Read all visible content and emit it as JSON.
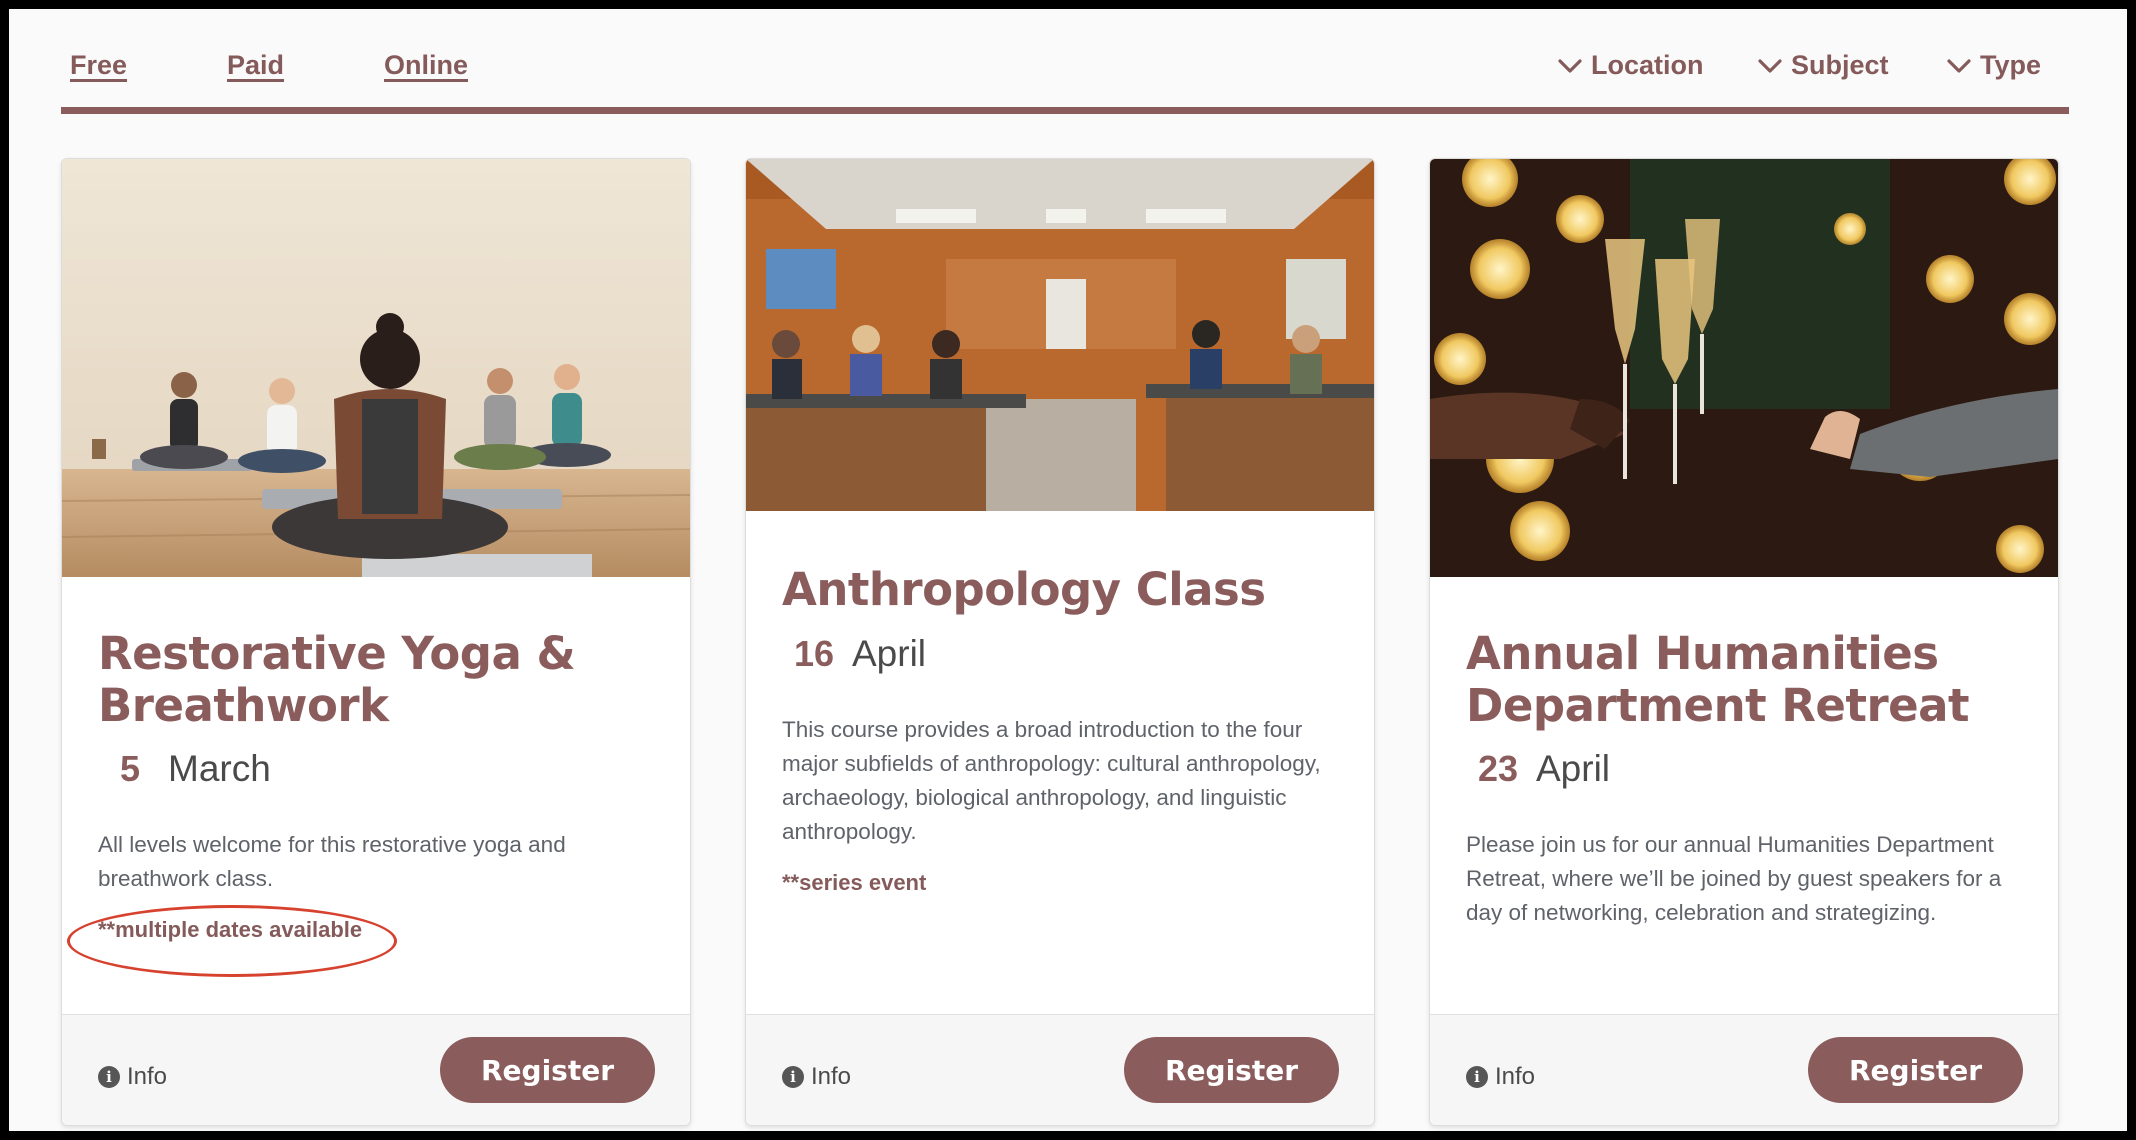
{
  "filters": {
    "links": [
      "Free",
      "Paid",
      "Online"
    ],
    "dropdowns": [
      "Location",
      "Subject",
      "Type"
    ]
  },
  "cards": [
    {
      "image_label": "Yoga class meditating on mats",
      "title": "Restorative Yoga & Breathwork",
      "day": "5",
      "month": "March",
      "description": "All levels welcome for this restorative yoga and breathwork class.",
      "note": "**multiple dates available",
      "info_label": "Info",
      "register_label": "Register"
    },
    {
      "image_label": "Students in an anthropology classroom",
      "title": "Anthropology Class",
      "day": "16",
      "month": "April",
      "description": "This course provides a broad introduction to the four major subfields of anthropology: cultural anthropology, archaeology, biological anthropology, and linguistic anthropology.",
      "note": "**series event",
      "info_label": "Info",
      "register_label": "Register"
    },
    {
      "image_label": "Champagne glasses toasting with festive lights",
      "title": "Annual Humanities Department Retreat",
      "day": "23",
      "month": "April",
      "description": "Please join us for our annual Humanities Department Retreat, where we’ll be joined by guest speakers for a day of networking, celebration and strategizing.",
      "info_label": "Info",
      "register_label": "Register"
    }
  ],
  "colors": {
    "accent": "#8a5c5c",
    "annotation_circle": "#d6422e",
    "body_text": "#5f6369"
  }
}
